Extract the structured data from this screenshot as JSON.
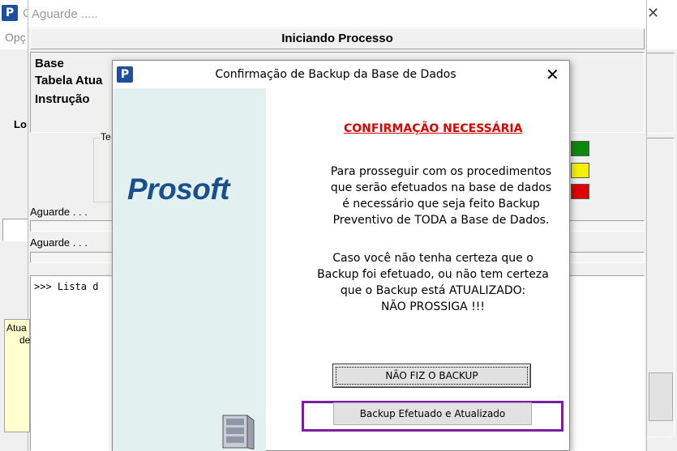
{
  "main_window": {
    "title_fragment": "C",
    "menu_fragment": "Opç",
    "close_glyph": "✕"
  },
  "aguarde_window": {
    "title": "Aguarde .....",
    "header": "Iniciando Processo",
    "labels": {
      "base": "Base",
      "tabela": "Tabela Atua",
      "instrucao": "Instrução"
    },
    "lo_fragment": "Lo",
    "group_fragment": "Te",
    "status1": "Aguarde . . .",
    "status2": "Aguarde . . .",
    "log_text": ">>> Lista d",
    "note_line1": "Atua",
    "note_line2": "de"
  },
  "indicators": [
    {
      "name": "green",
      "color": "#0a8a0a"
    },
    {
      "name": "yellow",
      "color": "#f0f000"
    },
    {
      "name": "red",
      "color": "#e00000"
    }
  ],
  "dialog": {
    "title": "Confirmação de Backup da Base de Dados",
    "close_glyph": "✕",
    "logo_text": "Prosoft",
    "heading": "CONFIRMAÇÃO NECESSÁRIA",
    "paragraph1": "Para prosseguir com os procedimentos\nque serão efetuados na base de dados\né necessário que seja feito Backup\nPreventivo de TODA a Base de Dados.",
    "paragraph2": "Caso você não tenha certeza que o\nBackup foi efetuado, ou não tem certeza\nque o Backup está ATUALIZADO:\nNÃO PROSSIGA !!!",
    "button_no_backup": "NÃO FIZ O BACKUP",
    "button_backup_done": "Backup Efetuado e Atualizado",
    "highlight_color": "#7b1fa2",
    "heading_color": "#e00000",
    "logo_color": "#1a4f8e",
    "panel_color": "#e3f0f0"
  }
}
